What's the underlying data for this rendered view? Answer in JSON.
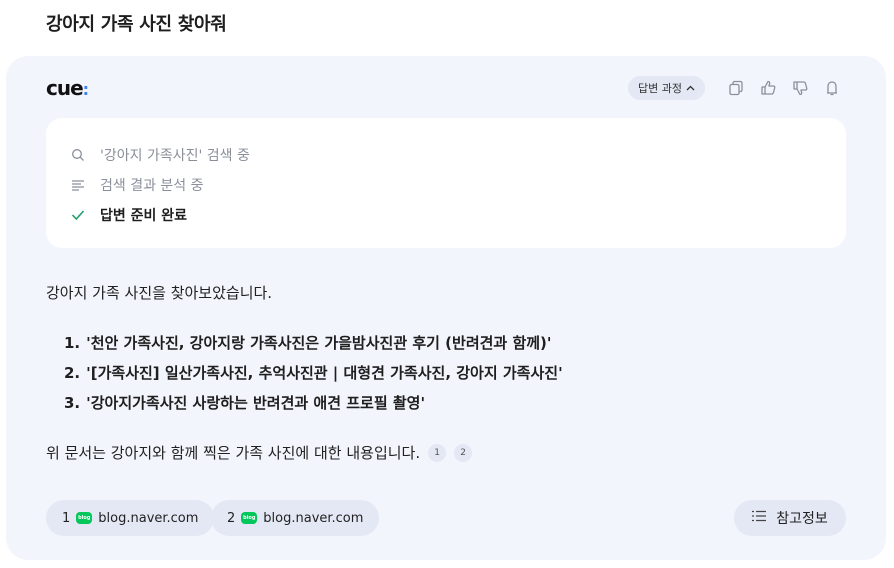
{
  "query": "강아지 가족 사진 찾아줘",
  "header": {
    "logo_text": "cue",
    "logo_dot": ":",
    "process_label": "답변 과정",
    "icons": [
      "copy-icon",
      "thumbs-up-icon",
      "thumbs-down-icon",
      "save-icon"
    ]
  },
  "steps": [
    {
      "icon": "search-icon",
      "label": "'강아지 가족사진' 검색 중"
    },
    {
      "icon": "list-icon",
      "label": "검색 결과 분석 중"
    },
    {
      "icon": "check-icon",
      "label": "답변 준비 완료"
    }
  ],
  "answer": {
    "intro": "강아지 가족 사진을 찾아보았습니다.",
    "results": [
      {
        "num": "1.",
        "text": "'천안 가족사진, 강아지랑 가족사진은 가을밤사진관 후기 (반려견과 함께)'"
      },
      {
        "num": "2.",
        "text": "'[가족사진] 일산가족사진, 추억사진관 | 대형견 가족사진, 강아지 가족사진'"
      },
      {
        "num": "3.",
        "text": "'강아지가족사진 사랑하는 반려견과 애견 프로필 촬영'"
      }
    ],
    "summary": "위 문서는 강아지와 함께 찍은 가족 사진에 대한 내용입니다.",
    "citations": [
      "1",
      "2"
    ]
  },
  "sources": [
    {
      "num": "1",
      "badge": "blog",
      "domain": "blog.naver.com"
    },
    {
      "num": "2",
      "badge": "blog",
      "domain": "blog.naver.com"
    }
  ],
  "reference_label": "참고정보",
  "colors": {
    "accent_blue": "#3b82f6",
    "naver_green": "#03c75a",
    "card_bg": "#f2f5fc",
    "check_green": "#1f9d6b"
  }
}
